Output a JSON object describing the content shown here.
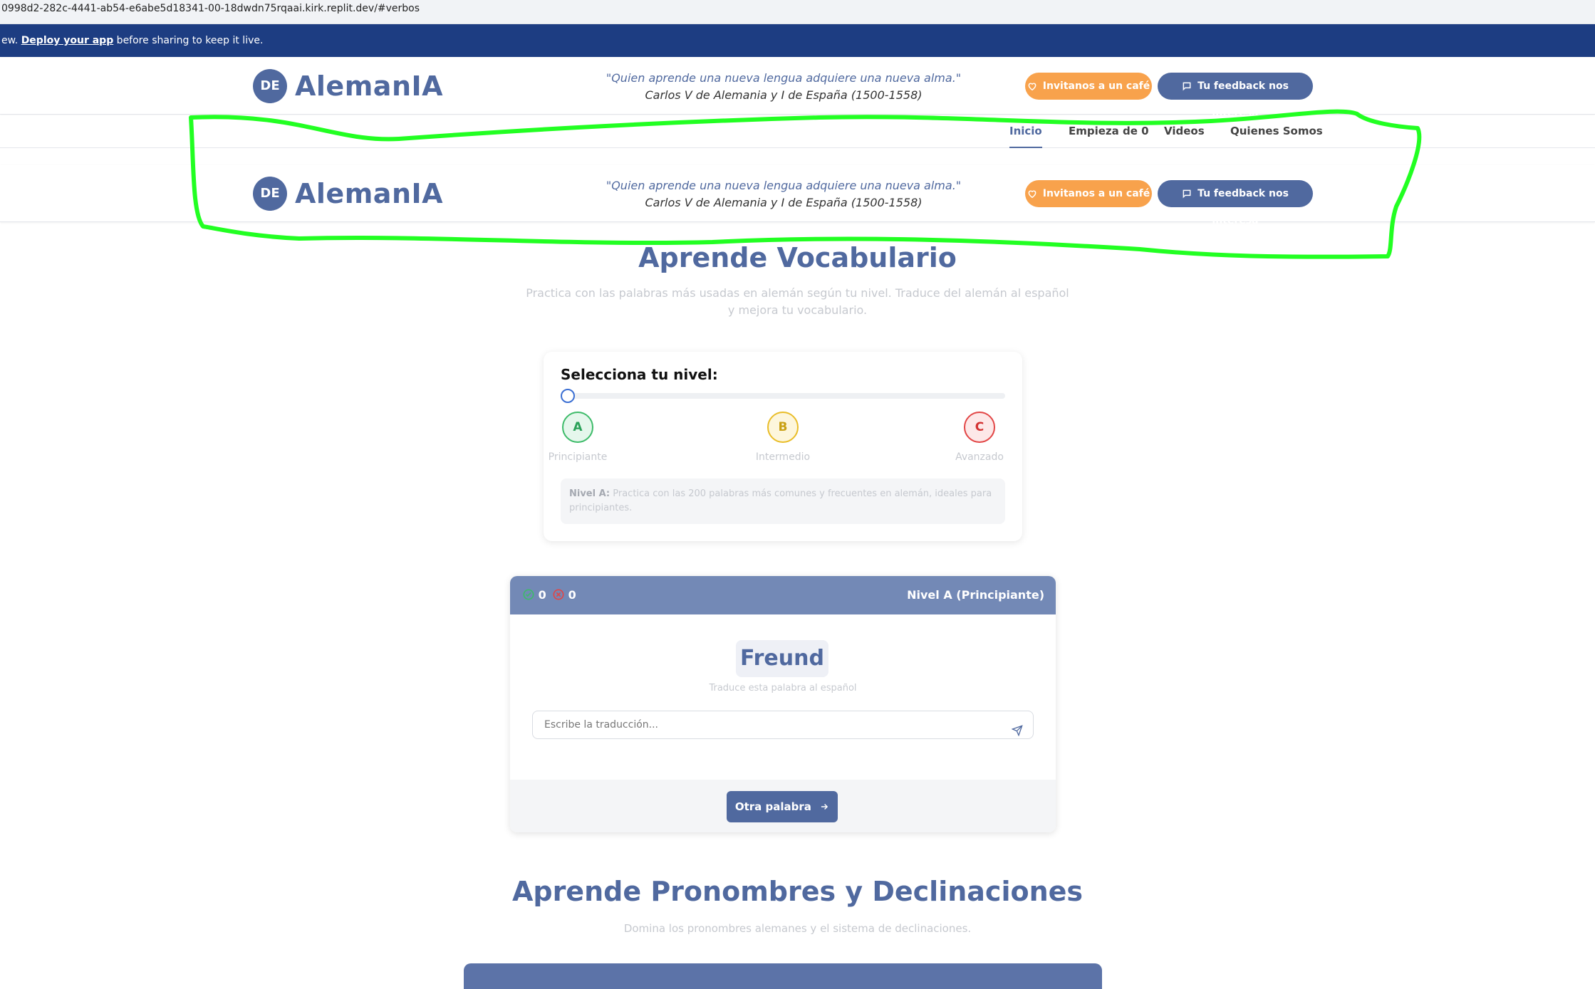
{
  "browser": {
    "url": "0998d2-282c-4441-ab54-e6abe5d18341-00-18dwdn75rqaai.kirk.replit.dev/#verbos"
  },
  "banner": {
    "prefix": "ew. ",
    "link": "Deploy your app",
    "suffix": " before sharing to keep it live."
  },
  "header": {
    "logo_badge": "DE",
    "logo_text": "AlemanIA",
    "quote": "\"Quien aprende una nueva lengua adquiere una nueva alma.\"",
    "quote_author": "Carlos V de Alemania y I de España (1500-1558)",
    "coffee_label": "Invitanos a un café",
    "feedback_label": "Tu feedback nos interesa"
  },
  "nav": {
    "items": [
      "Inicio",
      "Empieza de 0",
      "Videos",
      "Quienes Somos"
    ],
    "active": "Inicio"
  },
  "vocab": {
    "title": "Aprende Vocabulario",
    "subtitle_1": "Practica con las palabras más usadas en alemán según tu nivel. Traduce del alemán al español",
    "subtitle_2": "y mejora tu vocabulario."
  },
  "level_select": {
    "heading": "Selecciona tu nivel:",
    "slider_level": 0,
    "levels": [
      {
        "letter": "A",
        "label": "Principiante"
      },
      {
        "letter": "B",
        "label": "Intermedio"
      },
      {
        "letter": "C",
        "label": "Avanzado"
      }
    ],
    "desc_bold": "Nivel A:",
    "desc_text": " Practica con las 200 palabras más comunes y frecuentes en alemán, ideales para principiantes."
  },
  "quiz": {
    "correct": "0",
    "wrong": "0",
    "level_label": "Nivel A (Principiante)",
    "word": "Freund",
    "hint": "Traduce esta palabra al español",
    "input_placeholder": "Escribe la traducción...",
    "next_label": "Otra palabra"
  },
  "pronouns": {
    "title": "Aprende Pronombres y Declinaciones",
    "subtitle": "Domina los pronombres alemanes y el sistema de declinaciones."
  },
  "colors": {
    "brand": "#50699f",
    "coffee": "#f8a24c",
    "banner": "#1d3d82",
    "annotation": "#22ff22"
  }
}
